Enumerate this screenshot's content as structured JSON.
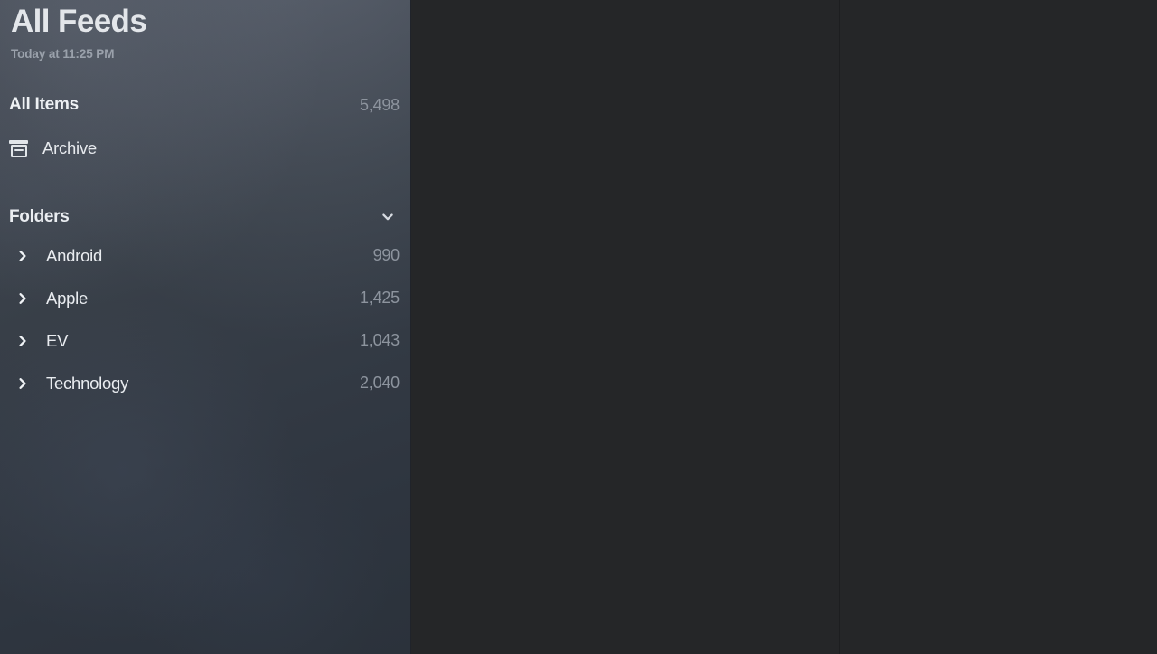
{
  "sidebar": {
    "title": "All Feeds",
    "subtitle": "Today at 11:25 PM",
    "all_items": {
      "label": "All Items",
      "count": "5,498"
    },
    "archive": {
      "label": "Archive",
      "icon": "archive-icon"
    },
    "folders_section": {
      "title": "Folders",
      "collapse_icon": "chevron-down-icon",
      "items": [
        {
          "label": "Android",
          "count": "990",
          "disclosure_icon": "chevron-right-icon"
        },
        {
          "label": "Apple",
          "count": "1,425",
          "disclosure_icon": "chevron-right-icon"
        },
        {
          "label": "EV",
          "count": "1,043",
          "disclosure_icon": "chevron-right-icon"
        },
        {
          "label": "Technology",
          "count": "2,040",
          "disclosure_icon": "chevron-right-icon"
        }
      ]
    }
  },
  "panes": {
    "list_pane": {
      "content": ""
    },
    "detail_pane": {
      "content": ""
    }
  },
  "colors": {
    "sidebar_base": "#333a43",
    "sidebar_highlight": "#474d57",
    "content_background": "#252628",
    "text_primary": "#e7eaee",
    "text_secondary": "#8f969f",
    "divider": "#1d1e20"
  }
}
